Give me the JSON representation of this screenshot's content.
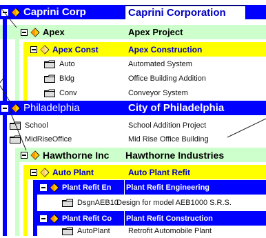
{
  "tree": {
    "caprini": {
      "code": "Caprini Corp",
      "name": "Caprini Corporation"
    },
    "apex": {
      "code": "Apex",
      "name": "Apex Project"
    },
    "apex_const": {
      "code": "Apex Const",
      "name": "Apex Construction"
    },
    "auto": {
      "code": "Auto",
      "name": "Automated System"
    },
    "bldg": {
      "code": "Bldg",
      "name": "Office Building Addition"
    },
    "conv": {
      "code": "Conv",
      "name": "Conveyor System"
    },
    "philadelphia": {
      "code": "Philadelphia",
      "name": "City of Philadelphia"
    },
    "school": {
      "code": "School",
      "name": "School Addition Project"
    },
    "midrise": {
      "code": "MidRiseOffice",
      "name": "Mid Rise Office Building"
    },
    "hawthorne": {
      "code": "Hawthorne Inc",
      "name": "Hawthorne Industries"
    },
    "auto_plant": {
      "code": "Auto Plant",
      "name": "Auto Plant Refit"
    },
    "refit_eng": {
      "code": "Plant Refit En",
      "name": "Plant Refit Engineering"
    },
    "dsgn": {
      "code": "DsgnAEB10",
      "name": "Design for model AEB1000 S.R.S."
    },
    "refit_con": {
      "code": "Plant Refit Co",
      "name": "Plant Refit Construction"
    },
    "autoplant": {
      "code": "AutoPlant",
      "name": "Retrofit Automobile Plant"
    }
  },
  "colors": {
    "blue": "#0000ff",
    "yellow": "#ffff00",
    "green": "#ccffcc",
    "navy": "#000099",
    "white": "#ffffff"
  },
  "icons": [
    "expand-collapse-icon",
    "diamond-icon",
    "folder-icon"
  ]
}
